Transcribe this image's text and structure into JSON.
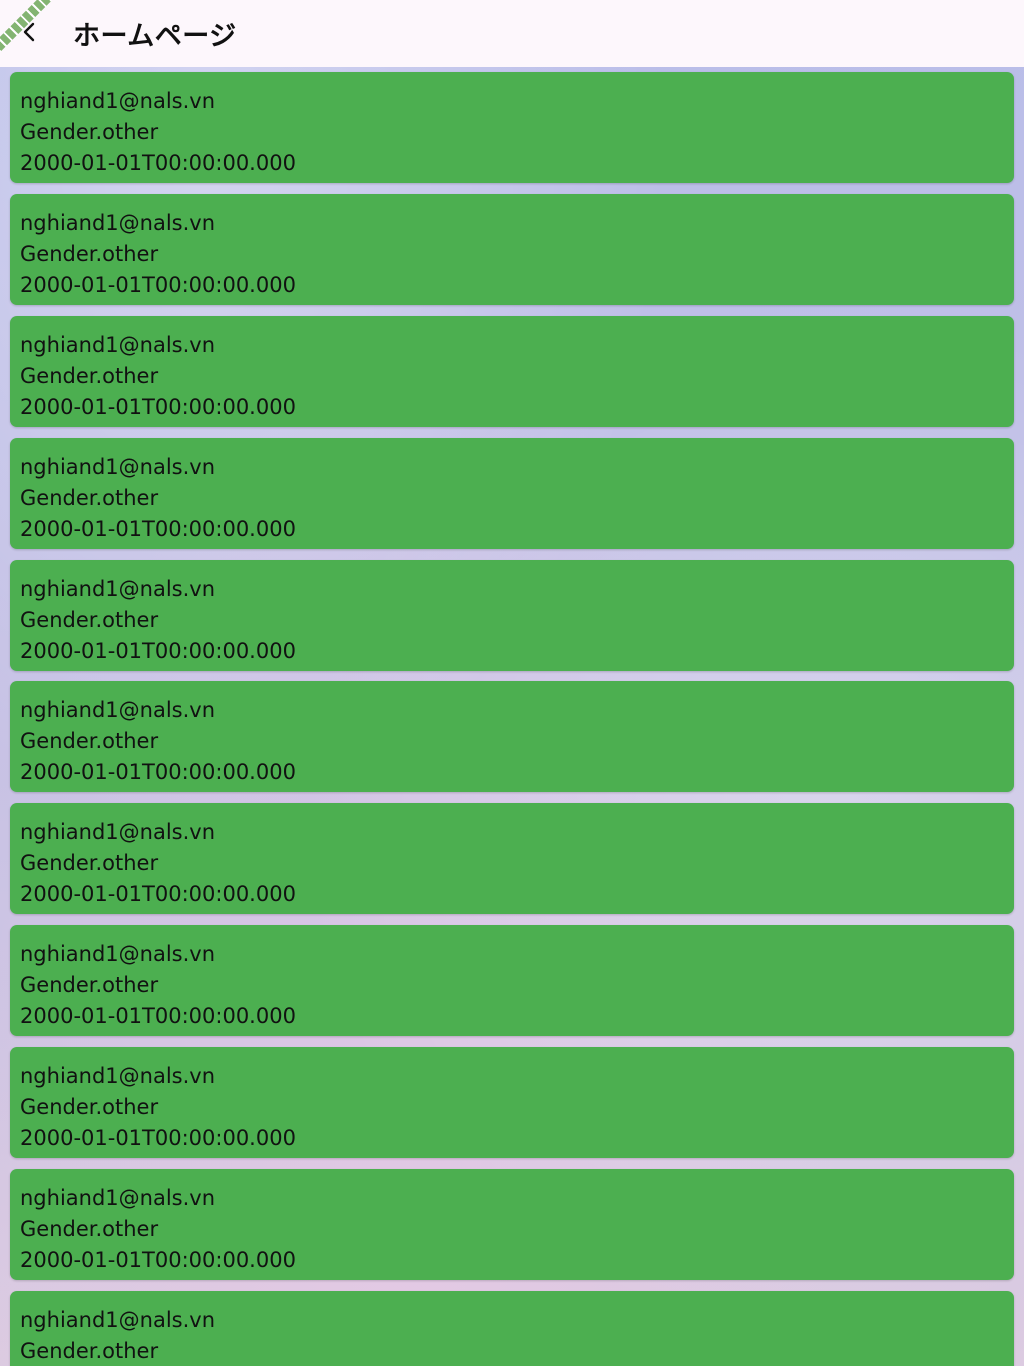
{
  "appbar": {
    "title": "ホームページ"
  },
  "colors": {
    "card": "#4caf50",
    "appbar": "#fdf7fc",
    "text": "#111111"
  },
  "users": [
    {
      "email": "nghiand1@nals.vn",
      "gender": "Gender.other",
      "birthday": "2000-01-01T00:00:00.000"
    },
    {
      "email": "nghiand1@nals.vn",
      "gender": "Gender.other",
      "birthday": "2000-01-01T00:00:00.000"
    },
    {
      "email": "nghiand1@nals.vn",
      "gender": "Gender.other",
      "birthday": "2000-01-01T00:00:00.000"
    },
    {
      "email": "nghiand1@nals.vn",
      "gender": "Gender.other",
      "birthday": "2000-01-01T00:00:00.000"
    },
    {
      "email": "nghiand1@nals.vn",
      "gender": "Gender.other",
      "birthday": "2000-01-01T00:00:00.000"
    },
    {
      "email": "nghiand1@nals.vn",
      "gender": "Gender.other",
      "birthday": "2000-01-01T00:00:00.000"
    },
    {
      "email": "nghiand1@nals.vn",
      "gender": "Gender.other",
      "birthday": "2000-01-01T00:00:00.000"
    },
    {
      "email": "nghiand1@nals.vn",
      "gender": "Gender.other",
      "birthday": "2000-01-01T00:00:00.000"
    },
    {
      "email": "nghiand1@nals.vn",
      "gender": "Gender.other",
      "birthday": "2000-01-01T00:00:00.000"
    },
    {
      "email": "nghiand1@nals.vn",
      "gender": "Gender.other",
      "birthday": "2000-01-01T00:00:00.000"
    },
    {
      "email": "nghiand1@nals.vn",
      "gender": "Gender.other"
    }
  ]
}
